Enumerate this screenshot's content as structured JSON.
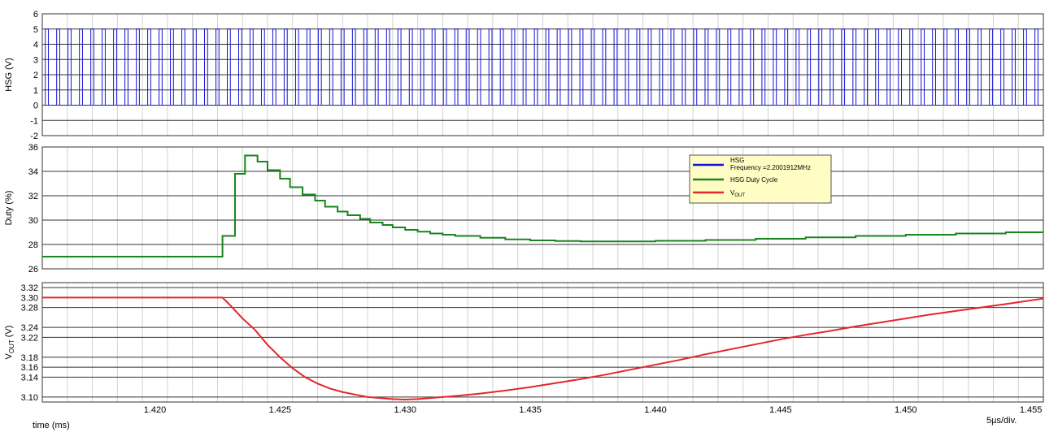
{
  "chart_data": [
    {
      "panel": "hsg",
      "type": "line",
      "ylabel": "HSG (V)",
      "ylim": [
        -2,
        6
      ],
      "yticks": [
        -2,
        -1,
        0,
        1,
        2,
        3,
        4,
        5,
        6
      ],
      "xlim": [
        1.4155,
        1.4555
      ],
      "grid": true,
      "series": [
        {
          "name": "HSG",
          "color": "#1515d6",
          "kind": "square-wave",
          "low": 0,
          "high": 5,
          "frequency_mhz": 2.2001912,
          "duty_percent_start": 27,
          "note_visible": "Frequency =2.2001912MHz"
        }
      ]
    },
    {
      "panel": "duty",
      "type": "line",
      "ylabel": "Duty (%)",
      "ylim": [
        26,
        36
      ],
      "yticks": [
        26,
        28,
        30,
        32,
        34,
        36
      ],
      "xlim": [
        1.4155,
        1.4555
      ],
      "grid": true,
      "series": [
        {
          "name": "HSG Duty Cycle",
          "color": "#18861c",
          "x": [
            1.4155,
            1.4227,
            1.4232,
            1.4236,
            1.4241,
            1.4245,
            1.425,
            1.4254,
            1.4259,
            1.4264,
            1.4268,
            1.4273,
            1.4277,
            1.4282,
            1.4286,
            1.4291,
            1.4295,
            1.43,
            1.4305,
            1.431,
            1.4315,
            1.432,
            1.433,
            1.434,
            1.435,
            1.436,
            1.437,
            1.438,
            1.44,
            1.442,
            1.444,
            1.446,
            1.448,
            1.45,
            1.452,
            1.454,
            1.4555
          ],
          "y": [
            27.0,
            28.7,
            33.8,
            35.3,
            34.8,
            34.1,
            33.4,
            32.7,
            32.1,
            31.6,
            31.1,
            30.7,
            30.4,
            30.1,
            29.8,
            29.6,
            29.4,
            29.2,
            29.05,
            28.9,
            28.8,
            28.7,
            28.55,
            28.42,
            28.33,
            28.28,
            28.25,
            28.25,
            28.3,
            28.37,
            28.47,
            28.58,
            28.7,
            28.8,
            28.9,
            29.0,
            29.1
          ],
          "step": true
        }
      ]
    },
    {
      "panel": "vout",
      "type": "line",
      "ylabel": "VOUT (V)",
      "xlabel": "time (ms)",
      "ylim": [
        3.09,
        3.33
      ],
      "yticks": [
        3.1,
        3.14,
        3.16,
        3.18,
        3.22,
        3.24,
        3.28,
        3.3,
        3.32
      ],
      "xlim": [
        1.4155,
        1.4555
      ],
      "xticks": [
        1.42,
        1.425,
        1.43,
        1.435,
        1.44,
        1.445,
        1.45,
        1.455
      ],
      "grid": true,
      "series": [
        {
          "name": "VOUT",
          "color": "#e5262a",
          "x": [
            1.4155,
            1.4227,
            1.423,
            1.4235,
            1.424,
            1.4245,
            1.425,
            1.4255,
            1.426,
            1.4265,
            1.427,
            1.4275,
            1.428,
            1.4285,
            1.429,
            1.4295,
            1.43,
            1.4305,
            1.431,
            1.432,
            1.433,
            1.434,
            1.435,
            1.436,
            1.437,
            1.438,
            1.439,
            1.44,
            1.441,
            1.442,
            1.443,
            1.444,
            1.445,
            1.446,
            1.447,
            1.448,
            1.449,
            1.45,
            1.451,
            1.452,
            1.453,
            1.454,
            1.4555
          ],
          "y": [
            3.3,
            3.3,
            3.285,
            3.258,
            3.235,
            3.205,
            3.18,
            3.158,
            3.14,
            3.127,
            3.117,
            3.11,
            3.105,
            3.1,
            3.098,
            3.096,
            3.095,
            3.096,
            3.098,
            3.102,
            3.107,
            3.113,
            3.12,
            3.128,
            3.136,
            3.145,
            3.155,
            3.165,
            3.175,
            3.186,
            3.196,
            3.206,
            3.216,
            3.225,
            3.233,
            3.242,
            3.25,
            3.258,
            3.266,
            3.273,
            3.28,
            3.287,
            3.298
          ]
        }
      ]
    }
  ],
  "legend": {
    "items": [
      {
        "label": "HSG",
        "sublabel": "Frequency =2.2001912MHz",
        "color": "#1515d6"
      },
      {
        "label": "HSG Duty Cycle",
        "sublabel": "",
        "color": "#18861c"
      },
      {
        "label": "V",
        "label_sub": "OUT",
        "color": "#e5262a"
      }
    ]
  },
  "footer": {
    "xlabel": "time (ms)",
    "scale": "5µs/div."
  }
}
